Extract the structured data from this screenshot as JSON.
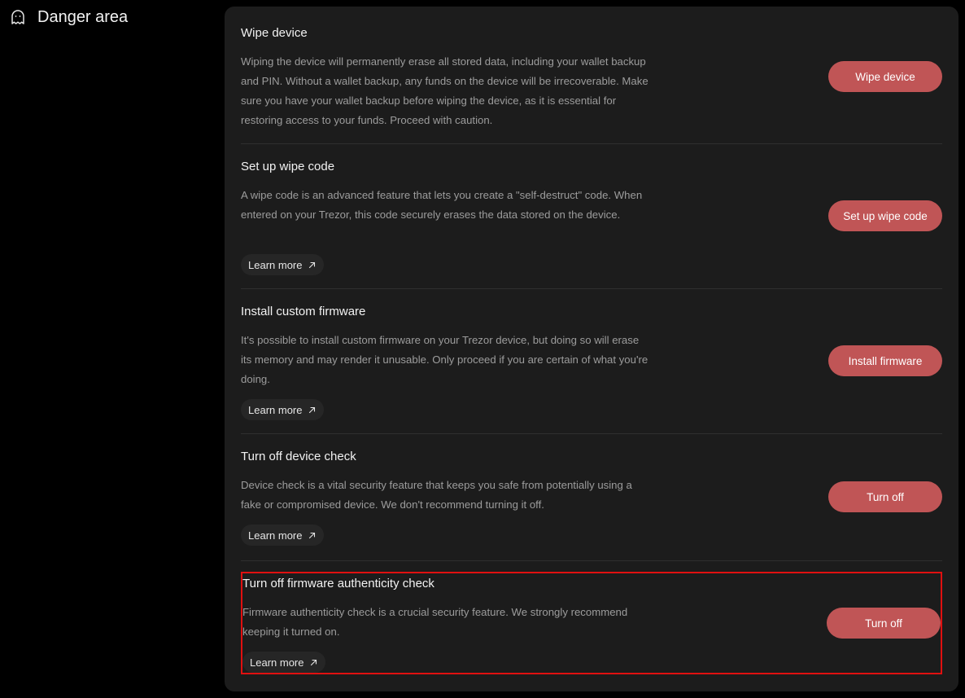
{
  "section": {
    "title": "Danger area",
    "icon": "ghost-icon"
  },
  "accent_color": "#c05556",
  "highlight_color": "#e01010",
  "rows": [
    {
      "title": "Wipe device",
      "description": "Wiping the device will permanently erase all stored data, including your wallet backup and PIN. Without a wallet backup, any funds on the device will be irrecoverable. Make sure you have your wallet backup before wiping the device, as it is essential for restoring access to your funds. Proceed with caution.",
      "button_label": "Wipe device"
    },
    {
      "title": "Set up wipe code",
      "description": "A wipe code is an advanced feature that lets you create a \"self-destruct\" code. When entered on your Trezor, this code securely erases the data stored on the device.",
      "learn_more": "Learn more",
      "button_label": "Set up wipe code"
    },
    {
      "title": "Install custom firmware",
      "description": "It's possible to install custom firmware on your Trezor device, but doing so will erase its memory and may render it unusable. Only proceed if you are certain of what you're doing.",
      "learn_more": "Learn more",
      "button_label": "Install firmware"
    },
    {
      "title": "Turn off device check",
      "description": "Device check is a vital security feature that keeps you safe from potentially using a fake or compromised device. We don't recommend turning it off.",
      "learn_more": "Learn more",
      "button_label": "Turn off"
    },
    {
      "title": "Turn off firmware authenticity check",
      "description": "Firmware authenticity check is a crucial security feature. We strongly recommend keeping it turned on.",
      "learn_more": "Learn more",
      "button_label": "Turn off"
    }
  ]
}
